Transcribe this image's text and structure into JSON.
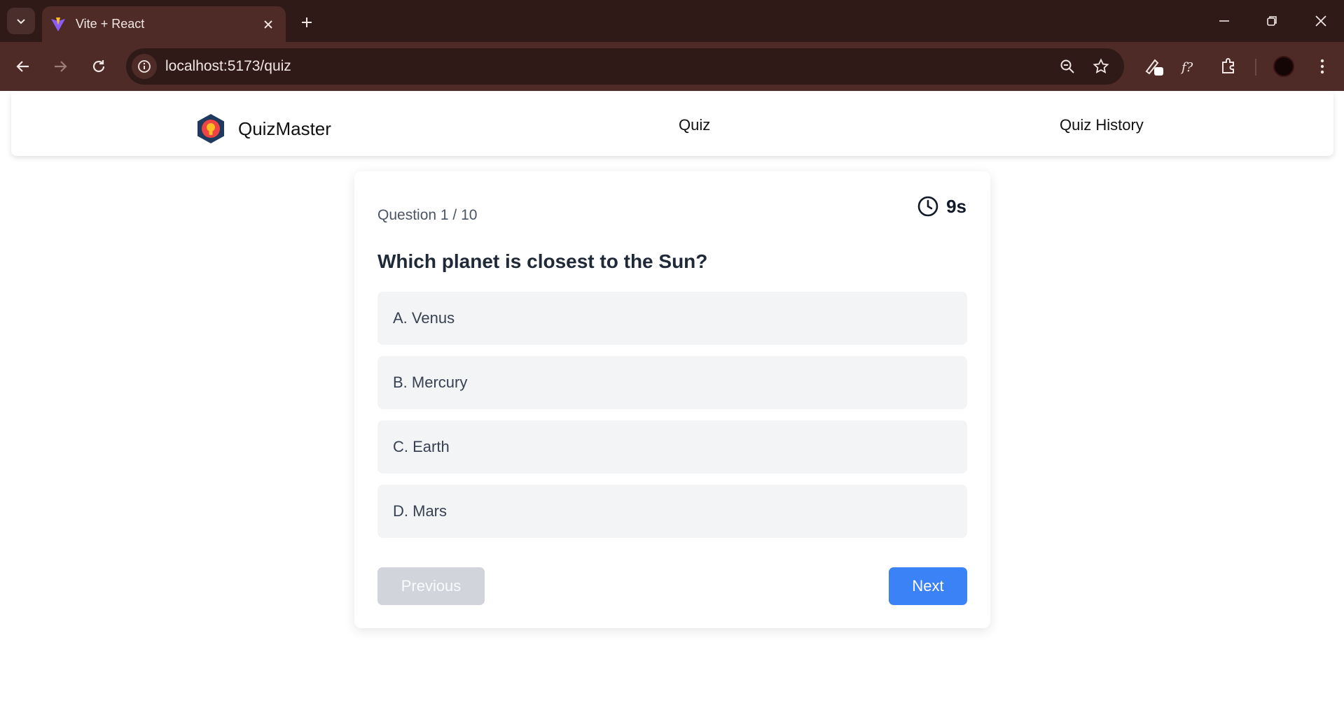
{
  "browser": {
    "tab_title": "Vite + React",
    "url": "localhost:5173/quiz",
    "colors": {
      "frame": "#2f1a18",
      "toolbar": "#4e2b27"
    }
  },
  "app": {
    "brand_name": "QuizMaster",
    "nav": {
      "quiz": "Quiz",
      "history": "Quiz History"
    }
  },
  "quiz": {
    "counter": "Question 1 / 10",
    "timer": "9s",
    "question": "Which planet is closest to the Sun?",
    "options": [
      "A. Venus",
      "B. Mercury",
      "C. Earth",
      "D. Mars"
    ],
    "previous_label": "Previous",
    "next_label": "Next",
    "colors": {
      "accent": "#3b82f6",
      "disabled": "#d1d5db",
      "option_bg": "#f3f4f6"
    }
  }
}
